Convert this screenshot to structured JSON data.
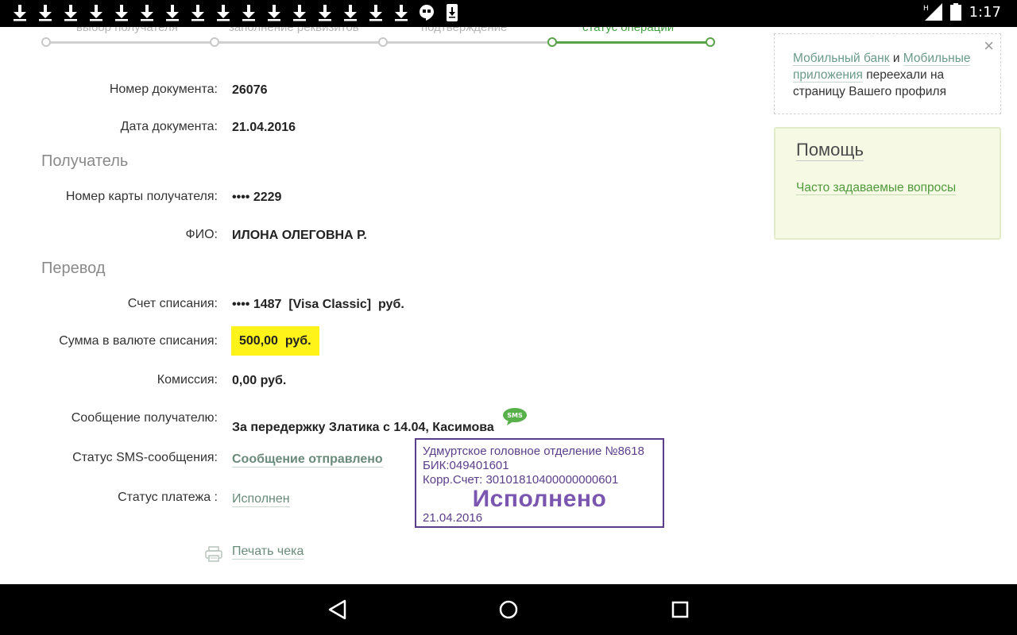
{
  "status_bar": {
    "time": "1:17",
    "download_icons": 16,
    "signal_label": "H"
  },
  "steps": [
    {
      "label": "выбор получателя",
      "active": false
    },
    {
      "label": "заполнение реквизитов",
      "active": false
    },
    {
      "label": "подтверждение",
      "active": false
    },
    {
      "label": "статус операции",
      "active": true
    }
  ],
  "document": {
    "number_label": "Номер документа:",
    "number_value": "26076",
    "date_label": "Дата документа:",
    "date_value": "21.04.2016"
  },
  "recipient": {
    "section_title": "Получатель",
    "card_label": "Номер карты получателя:",
    "card_value": "•••• 2229",
    "name_label": "ФИО:",
    "name_value": "ИЛОНА ОЛЕГОВНА Р."
  },
  "transfer": {
    "section_title": "Перевод",
    "account_label": "Счет списания:",
    "account_value": "•••• 1487  [Visa Classic]  руб.",
    "amount_label": "Сумма в валюте списания:",
    "amount_value": "500,00  руб.",
    "fee_label": "Комиссия:",
    "fee_value": "0,00 руб.",
    "message_label": "Сообщение получателю:",
    "message_value": "За передержку Златика с 14.04, Касимова",
    "sms_badge": "SMS",
    "sms_status_label": "Статус SMS-сообщения:",
    "sms_status_value": "Сообщение отправлено",
    "payment_status_label": "Статус платежа :",
    "payment_status_value": "Исполнен"
  },
  "stamp": {
    "line1": "Удмуртское головное отделение №8618",
    "line2": "БИК:049401601",
    "line3": "Корр.Счет: 30101810400000000601",
    "big": "Исполнено",
    "date": "21.04.2016"
  },
  "print_label": "Печать чека",
  "notice": {
    "link1": "Мобильный банк",
    "and": " и ",
    "link2": "Мобильные приложения",
    "rest": " переехали на страницу Вашего профиля",
    "close": "×"
  },
  "help": {
    "title": "Помощь",
    "faq_link": "Часто задаваемые вопросы"
  },
  "colors": {
    "accent_green": "#5aa34a",
    "highlight_yellow": "#fff31a",
    "stamp_purple": "#5b3e8a"
  }
}
